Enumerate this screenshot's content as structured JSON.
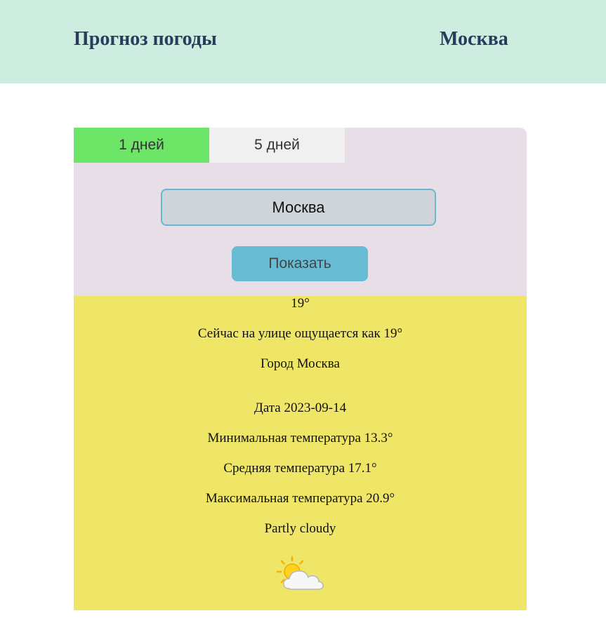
{
  "header": {
    "title": "Прогноз погоды",
    "city": "Москва"
  },
  "tabs": [
    {
      "label": "1 дней",
      "active": true
    },
    {
      "label": "5 дней",
      "active": false
    }
  ],
  "search": {
    "value": "Москва"
  },
  "show_button": {
    "label": "Показать"
  },
  "current": {
    "temperature": "19°",
    "feels_like": "Сейчас на улице ощущается как 19°",
    "city": "Город Москва"
  },
  "forecast": {
    "date": "Дата 2023-09-14",
    "min_temp": "Минимальная температура 13.3°",
    "avg_temp": "Средняя температура 17.1°",
    "max_temp": "Максимальная температура 20.9°",
    "condition": "Partly cloudy",
    "icon": "partly-cloudy-icon"
  },
  "colors": {
    "header_bg": "#cdede1",
    "title_color": "#2a3b5c",
    "panel_bg": "#e7dee8",
    "active_tab": "#6de567",
    "inactive_tab": "#f0f0f0",
    "input_bg": "#ced4d9",
    "input_border": "#6bb6cf",
    "button_bg": "#67bcd3",
    "result_bg": "#efe566"
  }
}
